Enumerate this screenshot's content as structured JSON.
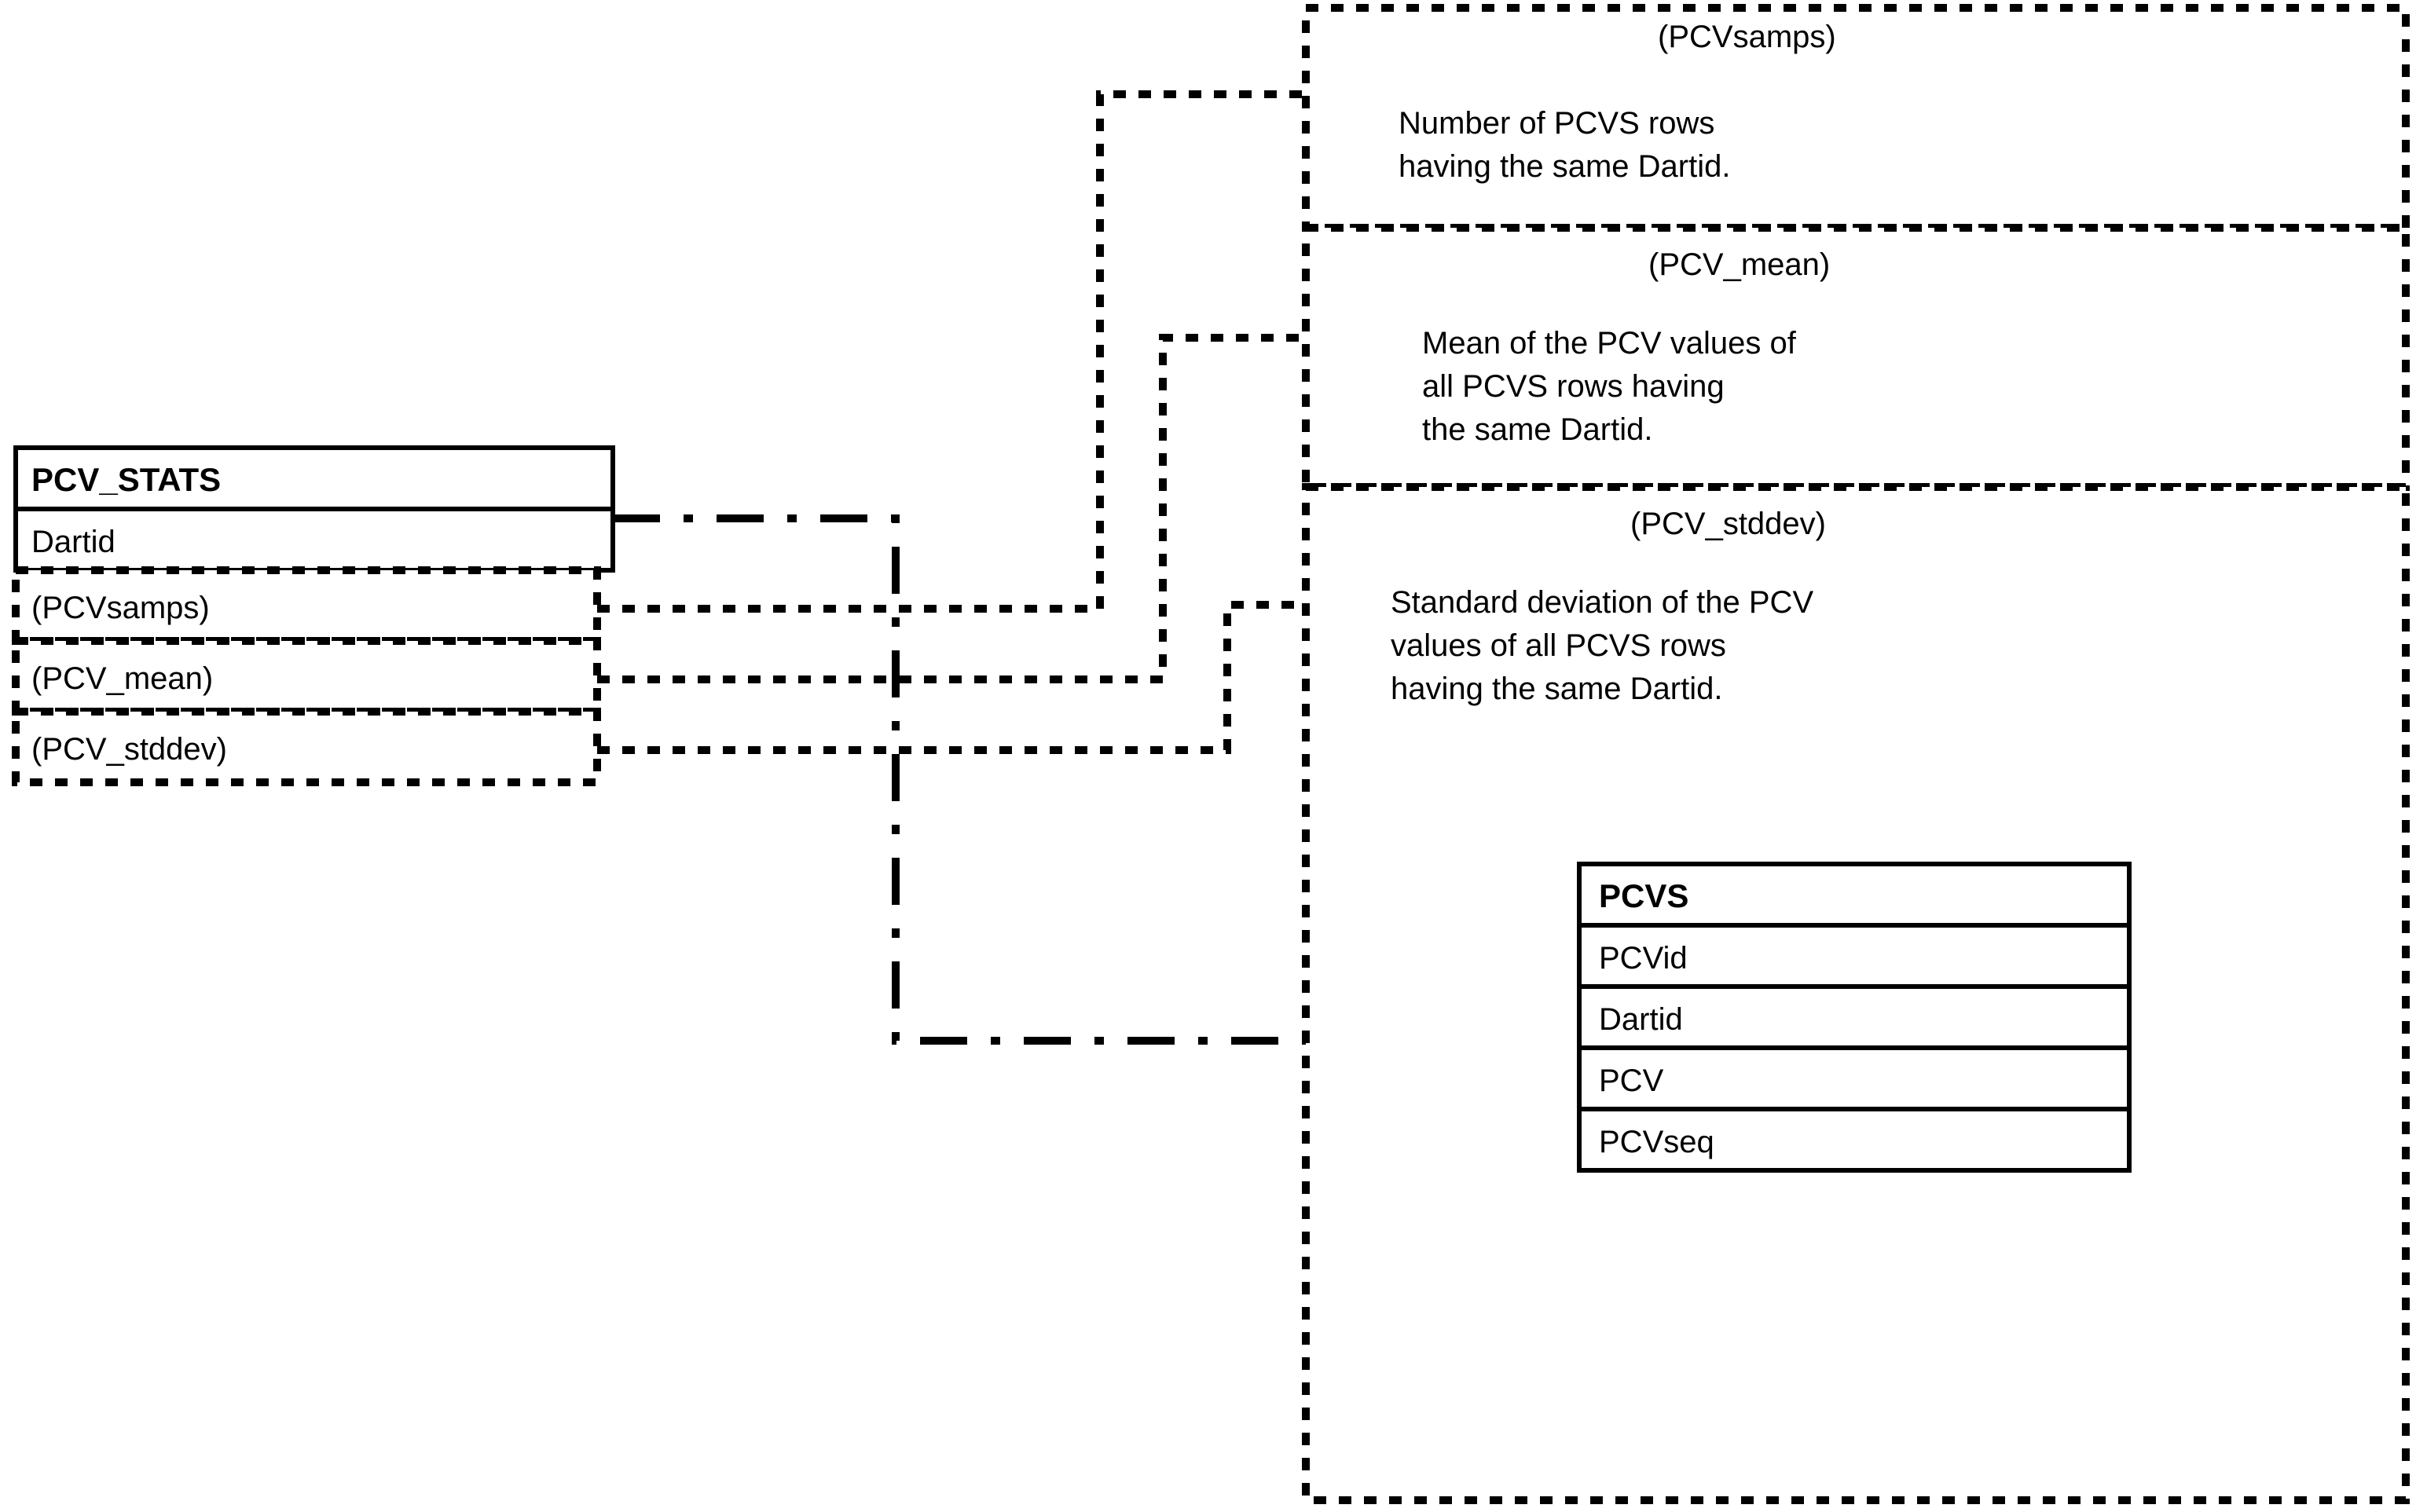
{
  "pcv_stats": {
    "title": "PCV_STATS",
    "rows": [
      "Dartid",
      "(PCVsamps)",
      "(PCV_mean)",
      "(PCV_stddev)"
    ]
  },
  "note_pcvsamps": {
    "title": "(PCVsamps)",
    "lines": [
      "Number of PCVS rows",
      "having the same Dartid."
    ]
  },
  "note_pcvmean": {
    "title": "(PCV_mean)",
    "lines": [
      "Mean of the PCV values of",
      "all PCVS rows having",
      "the same Dartid."
    ]
  },
  "note_pcvstddev": {
    "title": "(PCV_stddev)",
    "lines": [
      "Standard deviation of the PCV",
      "values of all PCVS rows",
      "having the same Dartid."
    ]
  },
  "pcvs": {
    "title": "PCVS",
    "rows": [
      "PCVid",
      "Dartid",
      "PCV",
      "PCVseq"
    ]
  }
}
